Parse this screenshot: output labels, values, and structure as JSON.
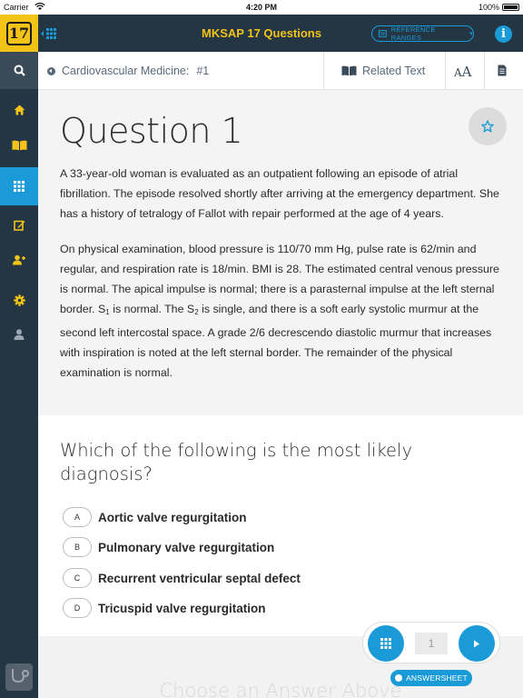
{
  "status_bar": {
    "carrier": "Carrier",
    "time": "4:20 PM",
    "battery": "100%"
  },
  "header": {
    "logo_text": "17",
    "title": "MKSAP 17 Questions",
    "reference_ranges_label": "REFERENCE RANGES",
    "info_label": "i"
  },
  "sidebar": {
    "items": [
      {
        "name": "search-icon"
      },
      {
        "name": "home-icon"
      },
      {
        "name": "book-icon"
      },
      {
        "name": "grid-icon",
        "active": true
      },
      {
        "name": "edit-icon"
      },
      {
        "name": "add-user-icon"
      },
      {
        "name": "gear-icon"
      },
      {
        "name": "user-icon"
      }
    ]
  },
  "breadcrumb": {
    "section": "Cardiovascular Medicine:",
    "number": "#1",
    "related_text": "Related Text",
    "font_small": "A",
    "font_large": "A"
  },
  "question": {
    "title": "Question 1",
    "paragraph1": "A 33-year-old woman is evaluated as an outpatient following an episode of atrial fibrillation. The episode resolved shortly after arriving at the emergency department. She has a history of tetralogy of Fallot with repair performed at the age of 4 years.",
    "p2_part1": "On physical examination, blood pressure is 110/70 mm Hg, pulse rate is 62/min and regular, and respiration rate is 18/min. BMI is 28. The estimated central venous pressure is normal. The apical impulse is normal; there is a parasternal impulse at the left sternal border. S",
    "p2_sub1": "1",
    "p2_part2": " is normal. The S",
    "p2_sub2": "2",
    "p2_part3": " is single, and there is a soft early systolic murmur at the second left intercostal space. A grade 2/6 decrescendo diastolic murmur that increases with inspiration is noted at the left sternal border. The remainder of the physical examination is normal.",
    "prompt": "Which of the following is the most likely diagnosis?"
  },
  "options": [
    {
      "letter": "A",
      "text": "Aortic valve regurgitation"
    },
    {
      "letter": "B",
      "text": "Pulmonary valve regurgitation"
    },
    {
      "letter": "C",
      "text": "Recurrent ventricular septal defect"
    },
    {
      "letter": "D",
      "text": "Tricuspid valve regurgitation"
    }
  ],
  "navigator": {
    "current": "1",
    "answersheet_label": "ANSWERSHEET",
    "choose_hint": "Choose an Answer Above"
  },
  "colors": {
    "accent": "#1a9bd7",
    "brand_yellow": "#f3c317",
    "navy": "#243544"
  }
}
